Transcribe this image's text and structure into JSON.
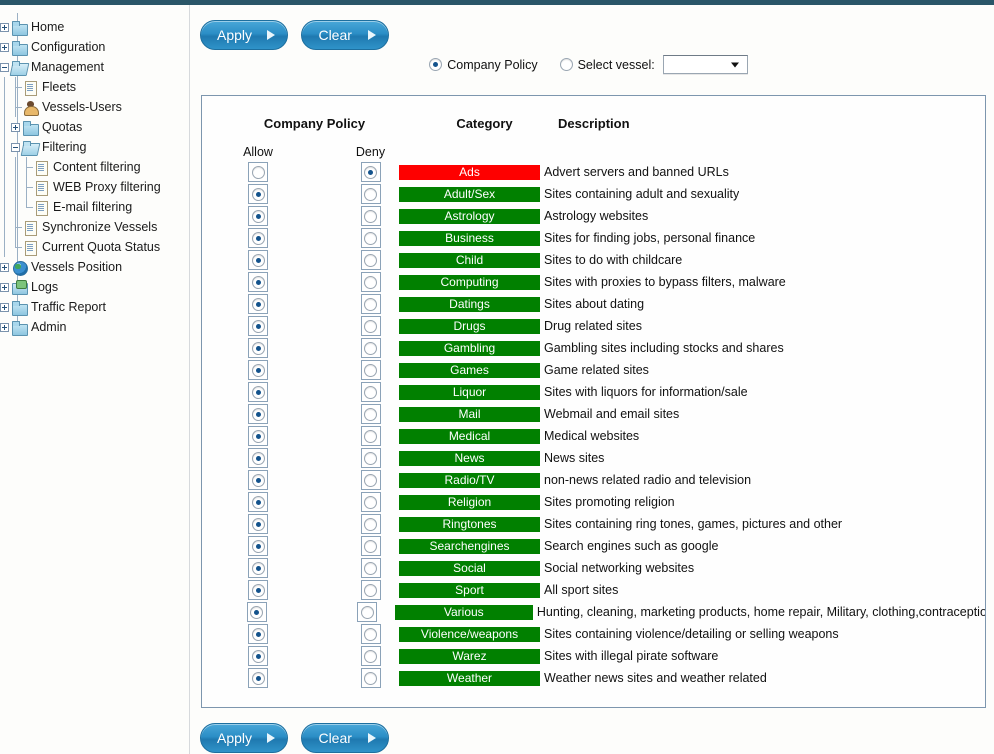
{
  "sidebar": {
    "items": [
      {
        "label": "Home",
        "icon": "folder-icon",
        "expander": "plus",
        "depth": 0,
        "connector": "none"
      },
      {
        "label": "Configuration",
        "icon": "folder-icon",
        "expander": "plus",
        "depth": 0,
        "connector": "none"
      },
      {
        "label": "Management",
        "icon": "folder-open-icon",
        "expander": "minus",
        "depth": 0,
        "connector": "none"
      },
      {
        "label": "Fleets",
        "icon": "document-icon",
        "expander": "none",
        "depth": 1,
        "connector": "tee"
      },
      {
        "label": "Vessels-Users",
        "icon": "user-icon",
        "expander": "none",
        "depth": 1,
        "connector": "tee"
      },
      {
        "label": "Quotas",
        "icon": "folder-icon",
        "expander": "plus",
        "depth": 1,
        "connector": "none"
      },
      {
        "label": "Filtering",
        "icon": "folder-open-icon",
        "expander": "minus",
        "depth": 1,
        "connector": "none"
      },
      {
        "label": "Content filtering",
        "icon": "document-icon",
        "expander": "none",
        "depth": 2,
        "connector": "tee"
      },
      {
        "label": "WEB Proxy filtering",
        "icon": "document-icon",
        "expander": "none",
        "depth": 2,
        "connector": "tee"
      },
      {
        "label": "E-mail filtering",
        "icon": "document-icon",
        "expander": "none",
        "depth": 2,
        "connector": "last"
      },
      {
        "label": "Synchronize Vessels",
        "icon": "document-icon",
        "expander": "none",
        "depth": 1,
        "connector": "tee"
      },
      {
        "label": "Current Quota Status",
        "icon": "document-icon",
        "expander": "none",
        "depth": 1,
        "connector": "last"
      },
      {
        "label": "Vessels Position",
        "icon": "globe-icon",
        "expander": "plus",
        "depth": 0,
        "connector": "none"
      },
      {
        "label": "Logs",
        "icon": "logs-icon",
        "expander": "plus",
        "depth": 0,
        "connector": "none"
      },
      {
        "label": "Traffic Report",
        "icon": "folder-icon",
        "expander": "plus",
        "depth": 0,
        "connector": "none"
      },
      {
        "label": "Admin",
        "icon": "folder-icon",
        "expander": "plus",
        "depth": 0,
        "connector": "none"
      }
    ]
  },
  "toolbar": {
    "apply_label": "Apply",
    "clear_label": "Clear"
  },
  "scope": {
    "company_policy_label": "Company Policy",
    "company_policy_selected": true,
    "select_vessel_label": "Select vessel:",
    "select_vessel_selected": false,
    "vessel_value": ""
  },
  "table": {
    "headers": {
      "policy": "Company Policy",
      "category": "Category",
      "description": "Description"
    },
    "subheaders": {
      "allow": "Allow",
      "deny": "Deny"
    },
    "colors": {
      "allow": "#018000",
      "deny": "#fe0000"
    },
    "rows": [
      {
        "category": "Ads",
        "description": "Advert servers and banned URLs",
        "state": "deny"
      },
      {
        "category": "Adult/Sex",
        "description": "Sites containing adult and sexuality",
        "state": "allow"
      },
      {
        "category": "Astrology",
        "description": "Astrology websites",
        "state": "allow"
      },
      {
        "category": "Business",
        "description": "Sites for finding jobs, personal finance",
        "state": "allow"
      },
      {
        "category": "Child",
        "description": "Sites to do with childcare",
        "state": "allow"
      },
      {
        "category": "Computing",
        "description": "Sites with proxies to bypass filters, malware",
        "state": "allow"
      },
      {
        "category": "Datings",
        "description": "Sites about dating",
        "state": "allow"
      },
      {
        "category": "Drugs",
        "description": "Drug related sites",
        "state": "allow"
      },
      {
        "category": "Gambling",
        "description": "Gambling sites including stocks and shares",
        "state": "allow"
      },
      {
        "category": "Games",
        "description": "Game related sites",
        "state": "allow"
      },
      {
        "category": "Liquor",
        "description": "Sites with liquors for information/sale",
        "state": "allow"
      },
      {
        "category": "Mail",
        "description": "Webmail and email sites",
        "state": "allow"
      },
      {
        "category": "Medical",
        "description": "Medical websites",
        "state": "allow"
      },
      {
        "category": "News",
        "description": "News sites",
        "state": "allow"
      },
      {
        "category": "Radio/TV",
        "description": "non-news related radio and television",
        "state": "allow"
      },
      {
        "category": "Religion",
        "description": "Sites promoting religion",
        "state": "allow"
      },
      {
        "category": "Ringtones",
        "description": "Sites containing ring tones, games, pictures and other",
        "state": "allow"
      },
      {
        "category": "Searchengines",
        "description": "Search engines such as google",
        "state": "allow"
      },
      {
        "category": "Social",
        "description": "Social networking websites",
        "state": "allow"
      },
      {
        "category": "Sport",
        "description": "All sport sites",
        "state": "allow"
      },
      {
        "category": "Various",
        "description": "Hunting, cleaning, marketing products, home repair, Military, clothing,contraception",
        "state": "allow"
      },
      {
        "category": "Violence/weapons",
        "description": "Sites containing violence/detailing or selling weapons",
        "state": "allow"
      },
      {
        "category": "Warez",
        "description": "Sites with illegal pirate software",
        "state": "allow"
      },
      {
        "category": "Weather",
        "description": "Weather news sites and weather related",
        "state": "allow"
      }
    ]
  }
}
